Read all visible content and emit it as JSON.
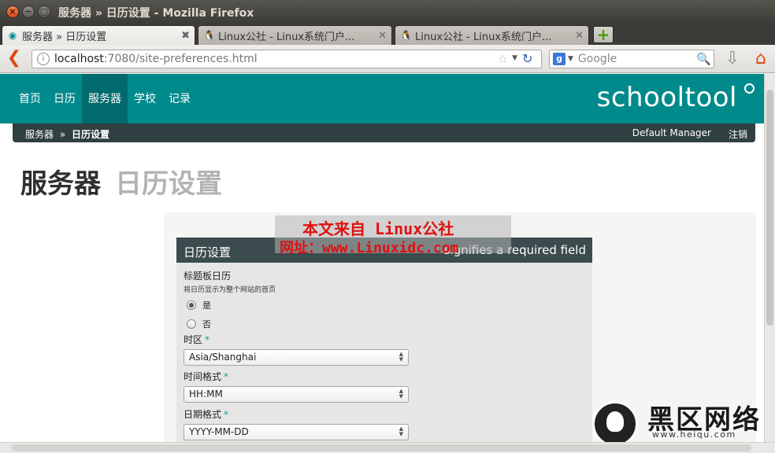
{
  "window": {
    "title": "服务器 » 日历设置 - Mozilla Firefox"
  },
  "tabs": [
    {
      "label": "服务器 » 日历设置",
      "active": true
    },
    {
      "label": "Linux公社 - Linux系统门户...",
      "active": false
    },
    {
      "label": "Linux公社 - Linux系统门户...",
      "active": false
    }
  ],
  "navbar": {
    "url_host": "localhost",
    "url_rest": ":7080/site-preferences.html",
    "search_placeholder": "Google"
  },
  "site": {
    "brand": "schooltool",
    "nav": [
      "首页",
      "日历",
      "服务器",
      "学校",
      "记录"
    ],
    "active_nav": "服务器",
    "breadcrumb": {
      "parent": "服务器",
      "separator": "»",
      "current": "日历设置"
    },
    "user": "Default Manager",
    "logout": "注销"
  },
  "page": {
    "title": "服务器",
    "subtitle": "日历设置"
  },
  "form": {
    "title": "日历设置",
    "required_star": "*",
    "required_note": "signifies a required field",
    "frontpage": {
      "label": "标题板日历",
      "hint": "将日历显示为整个网站的首页",
      "options": [
        {
          "label": "是",
          "checked": true
        },
        {
          "label": "否",
          "checked": false
        }
      ]
    },
    "timezone": {
      "label": "时区",
      "value": "Asia/Shanghai"
    },
    "time_format": {
      "label": "时间格式",
      "value": "HH:MM"
    },
    "date_format": {
      "label": "日期格式",
      "value": "YYYY-MM-DD"
    }
  },
  "watermarks": {
    "line1": "本文来自 Linux公社",
    "line2": "网址：www.Linuxidc.com",
    "logo_text": "黑区网络",
    "logo_url": "www.heiqu.com"
  }
}
